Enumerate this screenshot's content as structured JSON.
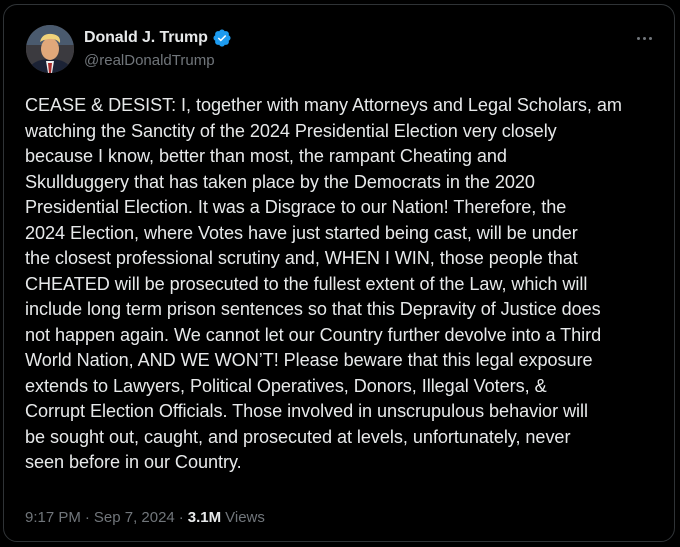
{
  "tweet": {
    "author": {
      "name": "Donald J. Trump",
      "handle": "@realDonaldTrump",
      "verified_icon": "verified-badge-icon",
      "verified_color": "#1d9bf0"
    },
    "text": "CEASE & DESIST: I, together with many Attorneys and Legal Scholars, am\nwatching the Sanctity of the 2024 Presidential Election very closely\nbecause I know, better than most, the rampant Cheating and\nSkullduggery that has taken place by the Democrats in the 2020\nPresidential Election. It was a Disgrace to our Nation! Therefore, the\n2024 Election, where Votes have just started being cast, will be under\nthe closest professional scrutiny and, WHEN I WIN, those people that\nCHEATED will be prosecuted to the fullest extent of the Law, which will\ninclude long term prison sentences so that this Depravity of Justice does\nnot happen again. We cannot let our Country further devolve into a Third\nWorld Nation, AND WE WON’T! Please beware that this legal exposure\nextends to Lawyers, Political Operatives, Donors, Illegal Voters, &\nCorrupt Election Officials. Those involved in unscrupulous behavior will\nbe sought out, caught, and prosecuted at levels, unfortunately, never\nseen before in our Country.",
    "time": "9:17 PM",
    "separator": "·",
    "date": "Sep 7, 2024",
    "views_count": "3.1M",
    "views_label": "Views"
  },
  "colors": {
    "background": "#000000",
    "text_primary": "#e7e9ea",
    "text_secondary": "#71767b",
    "border": "#2f3336"
  }
}
